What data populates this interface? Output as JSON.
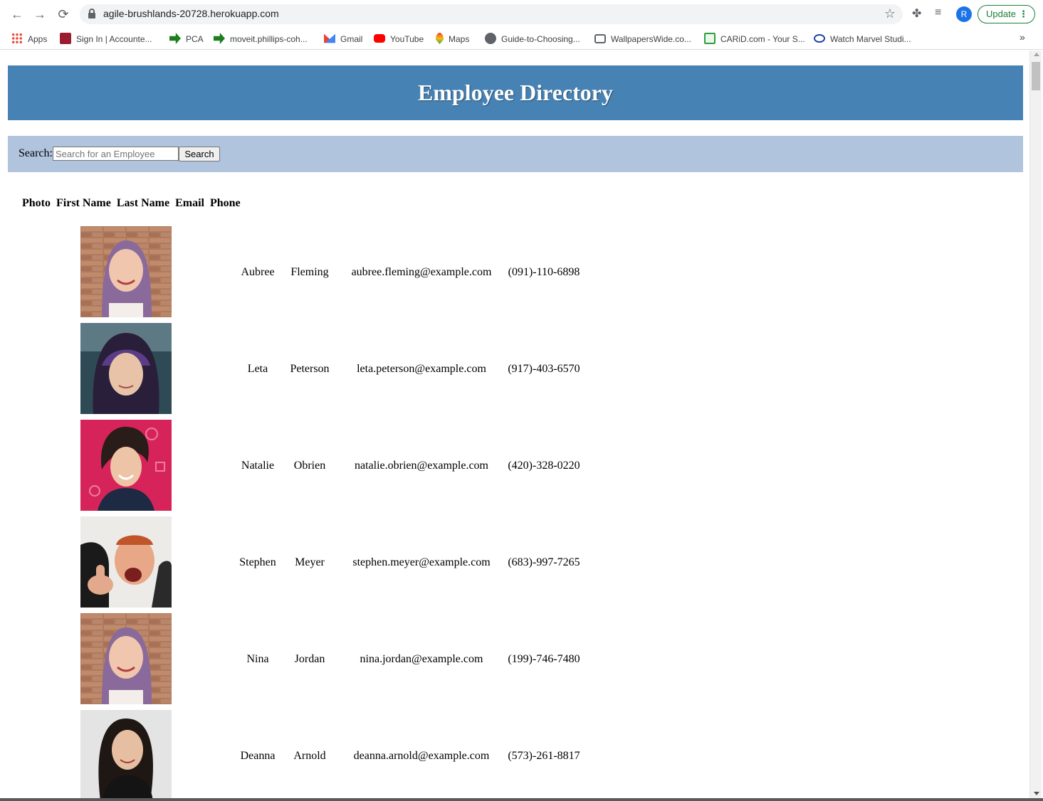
{
  "browser": {
    "url": "agile-brushlands-20728.herokuapp.com",
    "profile_initial": "R",
    "update_label": "Update",
    "bookmarks": [
      {
        "label": "Apps",
        "color": "#ea4335"
      },
      {
        "label": "Sign In | Accounte...",
        "color": "#9b1b30"
      },
      {
        "label": "PCA",
        "color": "#1e7e1e"
      },
      {
        "label": "moveit.phillips-coh...",
        "color": "#1e7e1e"
      },
      {
        "label": "Gmail",
        "color": "#ea4335"
      },
      {
        "label": "YouTube",
        "color": "#ff0000"
      },
      {
        "label": "Maps",
        "color": "#34a853"
      },
      {
        "label": "Guide-to-Choosing...",
        "color": "#5f6368"
      },
      {
        "label": "WallpapersWide.co...",
        "color": "#5f6368"
      },
      {
        "label": "CARiD.com - Your S...",
        "color": "#2e9e3e"
      },
      {
        "label": "Watch Marvel Studi...",
        "color": "#1a3ea8"
      }
    ],
    "more_label": "»"
  },
  "page": {
    "title": "Employee Directory",
    "header_color": "#4682b4",
    "search_bar_color": "#b0c4de",
    "search": {
      "label": "Search:",
      "placeholder": "Search for an Employee",
      "button_label": "Search"
    },
    "table": {
      "headers": [
        "Photo",
        "First Name",
        "Last Name",
        "Email",
        "Phone"
      ],
      "rows": [
        {
          "first": "Aubree",
          "last": "Fleming",
          "email": "aubree.fleming@example.com",
          "phone": "(091)-110-6898"
        },
        {
          "first": "Leta",
          "last": "Peterson",
          "email": "leta.peterson@example.com",
          "phone": "(917)-403-6570"
        },
        {
          "first": "Natalie",
          "last": "Obrien",
          "email": "natalie.obrien@example.com",
          "phone": "(420)-328-0220"
        },
        {
          "first": "Stephen",
          "last": "Meyer",
          "email": "stephen.meyer@example.com",
          "phone": "(683)-997-7265"
        },
        {
          "first": "Nina",
          "last": "Jordan",
          "email": "nina.jordan@example.com",
          "phone": "(199)-746-7480"
        },
        {
          "first": "Deanna",
          "last": "Arnold",
          "email": "deanna.arnold@example.com",
          "phone": "(573)-261-8817"
        }
      ]
    }
  }
}
